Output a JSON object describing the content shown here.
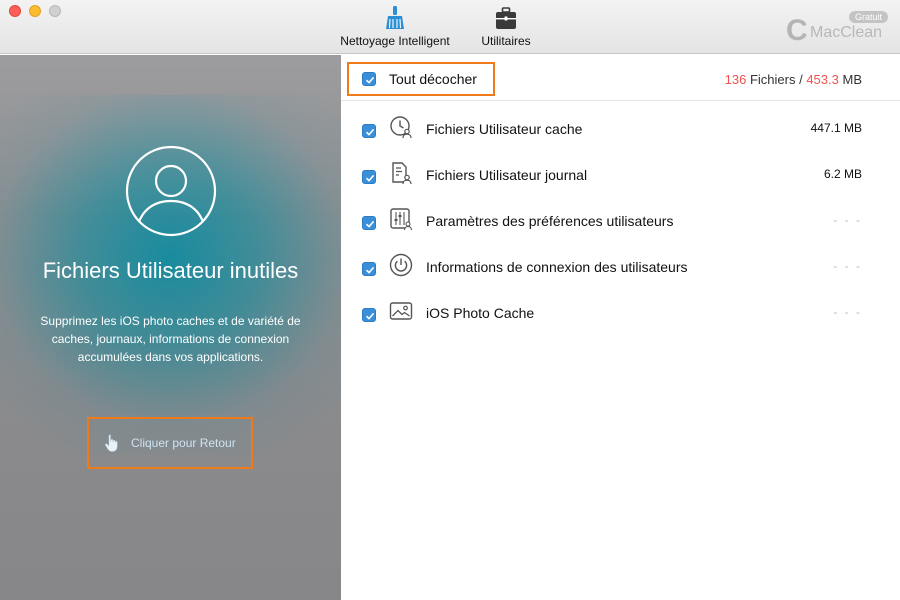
{
  "toolbar": {
    "items": [
      {
        "label": "Nettoyage Intelligent",
        "icon": "broom-icon"
      },
      {
        "label": "Utilitaires",
        "icon": "toolbox-icon"
      }
    ]
  },
  "brand": {
    "badge": "Gratuit",
    "mark": "C",
    "name": "MacClean"
  },
  "left_panel": {
    "icon": "user-profile-icon",
    "title": "Fichiers Utilisateur inutiles",
    "description": "Supprimez les iOS photo caches et de variété de caches, journaux,  informations de connexion accumulées dans vos applications.",
    "back_button": {
      "label": "Cliquer pour Retour",
      "icon": "hand-pointer-icon"
    }
  },
  "right_panel": {
    "select_all": {
      "label": "Tout décocher",
      "checked": true
    },
    "summary": {
      "count": "136",
      "count_label": " Fichiers / ",
      "size": "453.3",
      "size_unit": " MB"
    },
    "items": [
      {
        "label": "Fichiers Utilisateur cache",
        "size": "447.1 MB",
        "icon": "clock-user-icon",
        "checked": true
      },
      {
        "label": "Fichiers Utilisateur journal",
        "size": "6.2 MB",
        "icon": "document-user-icon",
        "checked": true
      },
      {
        "label": "Paramètres des préférences utilisateurs",
        "size": "- - -",
        "icon": "sliders-icon",
        "checked": true
      },
      {
        "label": "Informations de connexion des utilisateurs",
        "size": "- - -",
        "icon": "power-icon",
        "checked": true
      },
      {
        "label": "iOS Photo Cache",
        "size": "- - -",
        "icon": "photo-icon",
        "checked": true
      }
    ]
  },
  "colors": {
    "accent_orange": "#ee7a1a",
    "checkbox_blue": "#3a8fd9",
    "count_red": "#ef5350",
    "panel_teal": "#128ca0"
  }
}
